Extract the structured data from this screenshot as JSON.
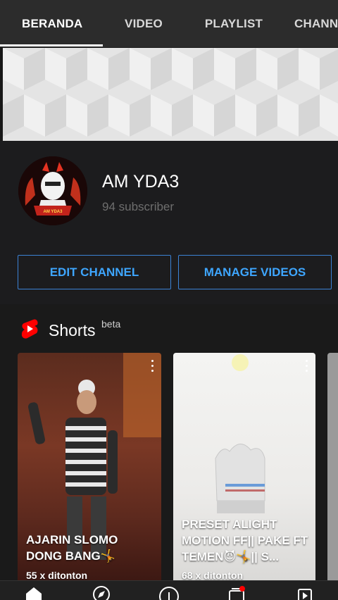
{
  "tabs": [
    {
      "label": "BERANDA",
      "active": true
    },
    {
      "label": "VIDEO",
      "active": false
    },
    {
      "label": "PLAYLIST",
      "active": false
    },
    {
      "label": "CHANN",
      "active": false
    }
  ],
  "channel": {
    "name": "AM YDA3",
    "subscribers": "94 subscriber",
    "avatar_badge_text": "AM YDA3"
  },
  "buttons": {
    "edit_channel": "EDIT CHANNEL",
    "manage_videos": "MANAGE VIDEOS"
  },
  "shorts": {
    "title": "Shorts",
    "badge": "beta",
    "items": [
      {
        "title": "AJARIN SLOMO DONG BANG🤸",
        "views": "55 x ditonton"
      },
      {
        "title": "PRESET ALIGHT MOTION FF|| PAKE FT TEMEN😈🤸|| S...",
        "views": "68 x ditonton"
      }
    ]
  },
  "bottom_nav": [
    "home-icon",
    "explore-icon",
    "create-icon",
    "subscriptions-icon",
    "library-icon"
  ],
  "colors": {
    "accent_blue": "#3ea6ff",
    "shorts_red": "#ff0000",
    "notification_dot": "#ff0000",
    "background": "#181818"
  }
}
